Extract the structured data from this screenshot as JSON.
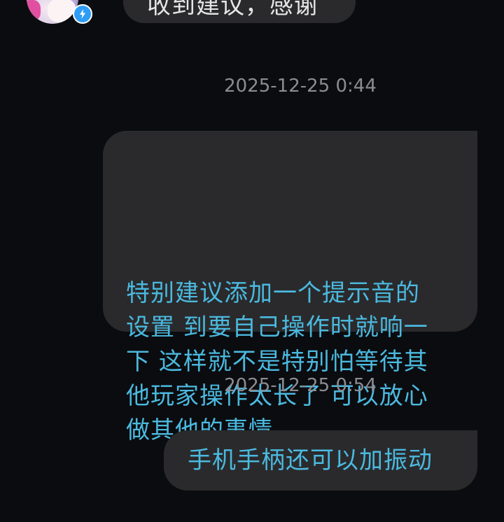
{
  "previous_message": {
    "text": "收到建议，感谢"
  },
  "messages": [
    {
      "timestamp": "2025-12-25 0:44",
      "lines": [
        "特别建议添加一个提示音的",
        "设置 到要自己操作时就响一",
        "下 这样就不是特别怕等待其",
        "他玩家操作太长了 可以放心",
        "做其他的事情"
      ]
    },
    {
      "timestamp": "2025-12-25 0:54",
      "text": "手机手柄还可以加振动"
    }
  ],
  "avatar": {
    "badge_icon": "lightning-icon",
    "badge_color": "#2f9df5"
  },
  "colors": {
    "background": "#0b0c0f",
    "bubble": "#2a2a2c",
    "self_text": "#4bb9df",
    "other_text": "#e6e6e6",
    "timestamp": "#8d8d91"
  }
}
